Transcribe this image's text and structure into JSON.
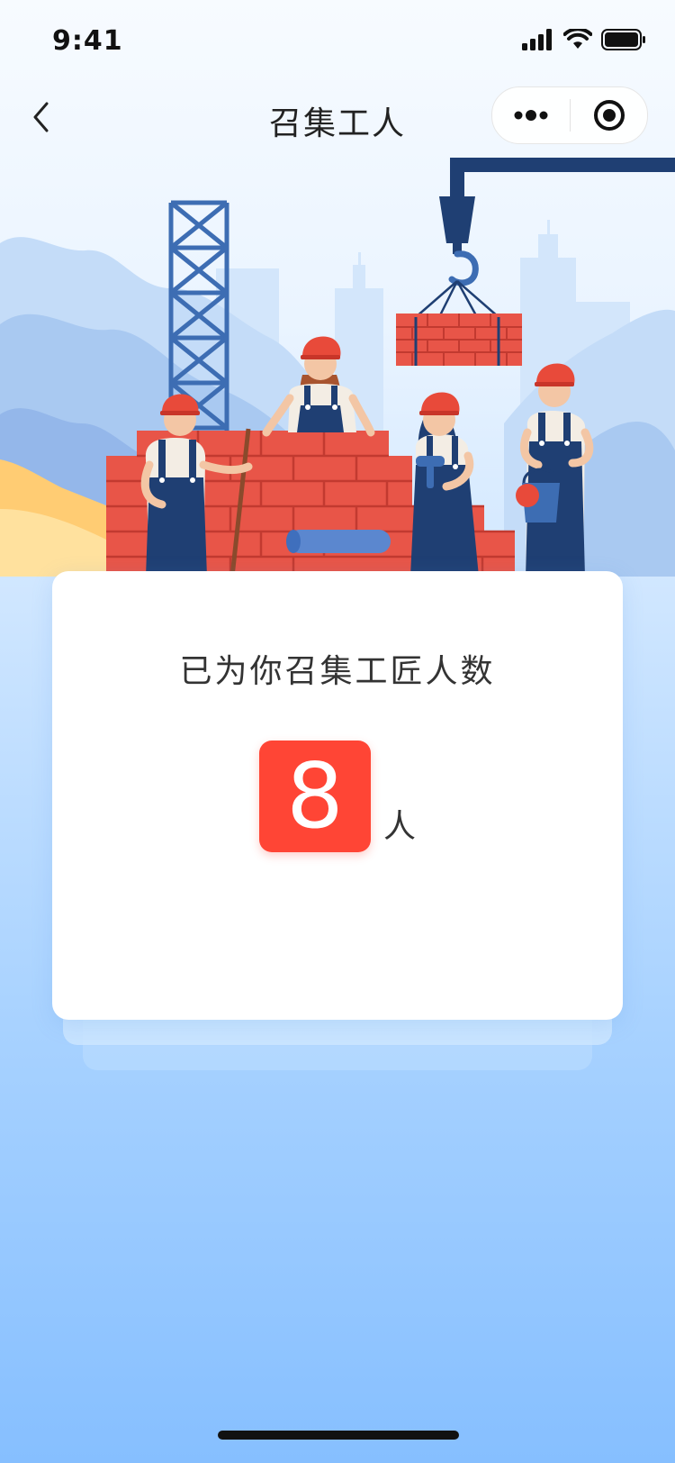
{
  "status_bar": {
    "time": "9:41"
  },
  "nav": {
    "title": "召集工人"
  },
  "card": {
    "heading": "已为你召集工匠人数",
    "count": "8",
    "unit": "人"
  },
  "colors": {
    "accent": "#ff4535",
    "crane": "#1f3f73",
    "brick": "#e85548",
    "background_top": "#f7fbff",
    "background_bottom": "#86bfff"
  },
  "icons": {
    "back": "chevron-left-icon",
    "more": "more-dots-icon",
    "close": "target-circle-icon"
  }
}
